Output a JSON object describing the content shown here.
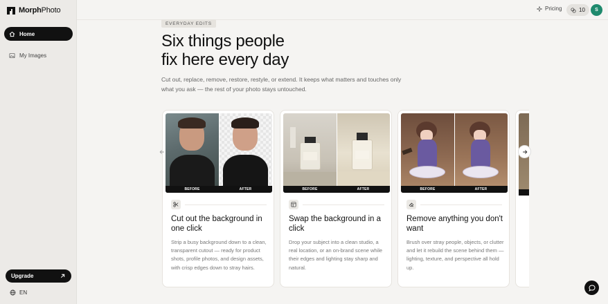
{
  "app": {
    "logo_bold": "Morph",
    "logo_light": "Photo"
  },
  "sidebar": {
    "items": [
      {
        "label": "Home",
        "icon": "home-icon",
        "active": true
      },
      {
        "label": "My Images",
        "icon": "image-icon",
        "active": false
      }
    ],
    "upgrade_label": "Upgrade",
    "upgrade_icon": "arrow-up-right-icon",
    "language": "EN"
  },
  "header": {
    "pricing_label": "Pricing",
    "credits": "10",
    "avatar_initial": "S"
  },
  "hero": {
    "eyebrow": "EVERYDAY EDITS",
    "title_line1": "Six things people",
    "title_line2": "fix here every day",
    "description": "Cut out, replace, remove, restore, restyle, or extend. It keeps what matters and touches only what you ask — the rest of your photo stays untouched."
  },
  "cards": [
    {
      "before": "BEFORE",
      "after": "AFTER",
      "icon": "scissors-icon",
      "title": "Cut out the background in one click",
      "description": "Strip a busy background down to a clean, transparent cutout — ready for product shots, profile photos, and design assets, with crisp edges down to stray hairs."
    },
    {
      "before": "BEFORE",
      "after": "AFTER",
      "icon": "layout-icon",
      "title": "Swap the background in a click",
      "description": "Drop your subject into a clean studio, a real location, or an on-brand scene while their edges and lighting stay sharp and natural."
    },
    {
      "before": "BEFORE",
      "after": "AFTER",
      "icon": "eraser-icon",
      "title": "Remove anything you don't want",
      "description": "Brush over stray people, objects, or clutter and let it rebuild the scene behind them — lighting, texture, and perspective all hold up."
    }
  ],
  "colors": {
    "accent": "#111111",
    "avatar": "#1f8a6d",
    "page_bg": "#f5f4f2",
    "sidebar_bg": "#eceae7"
  }
}
